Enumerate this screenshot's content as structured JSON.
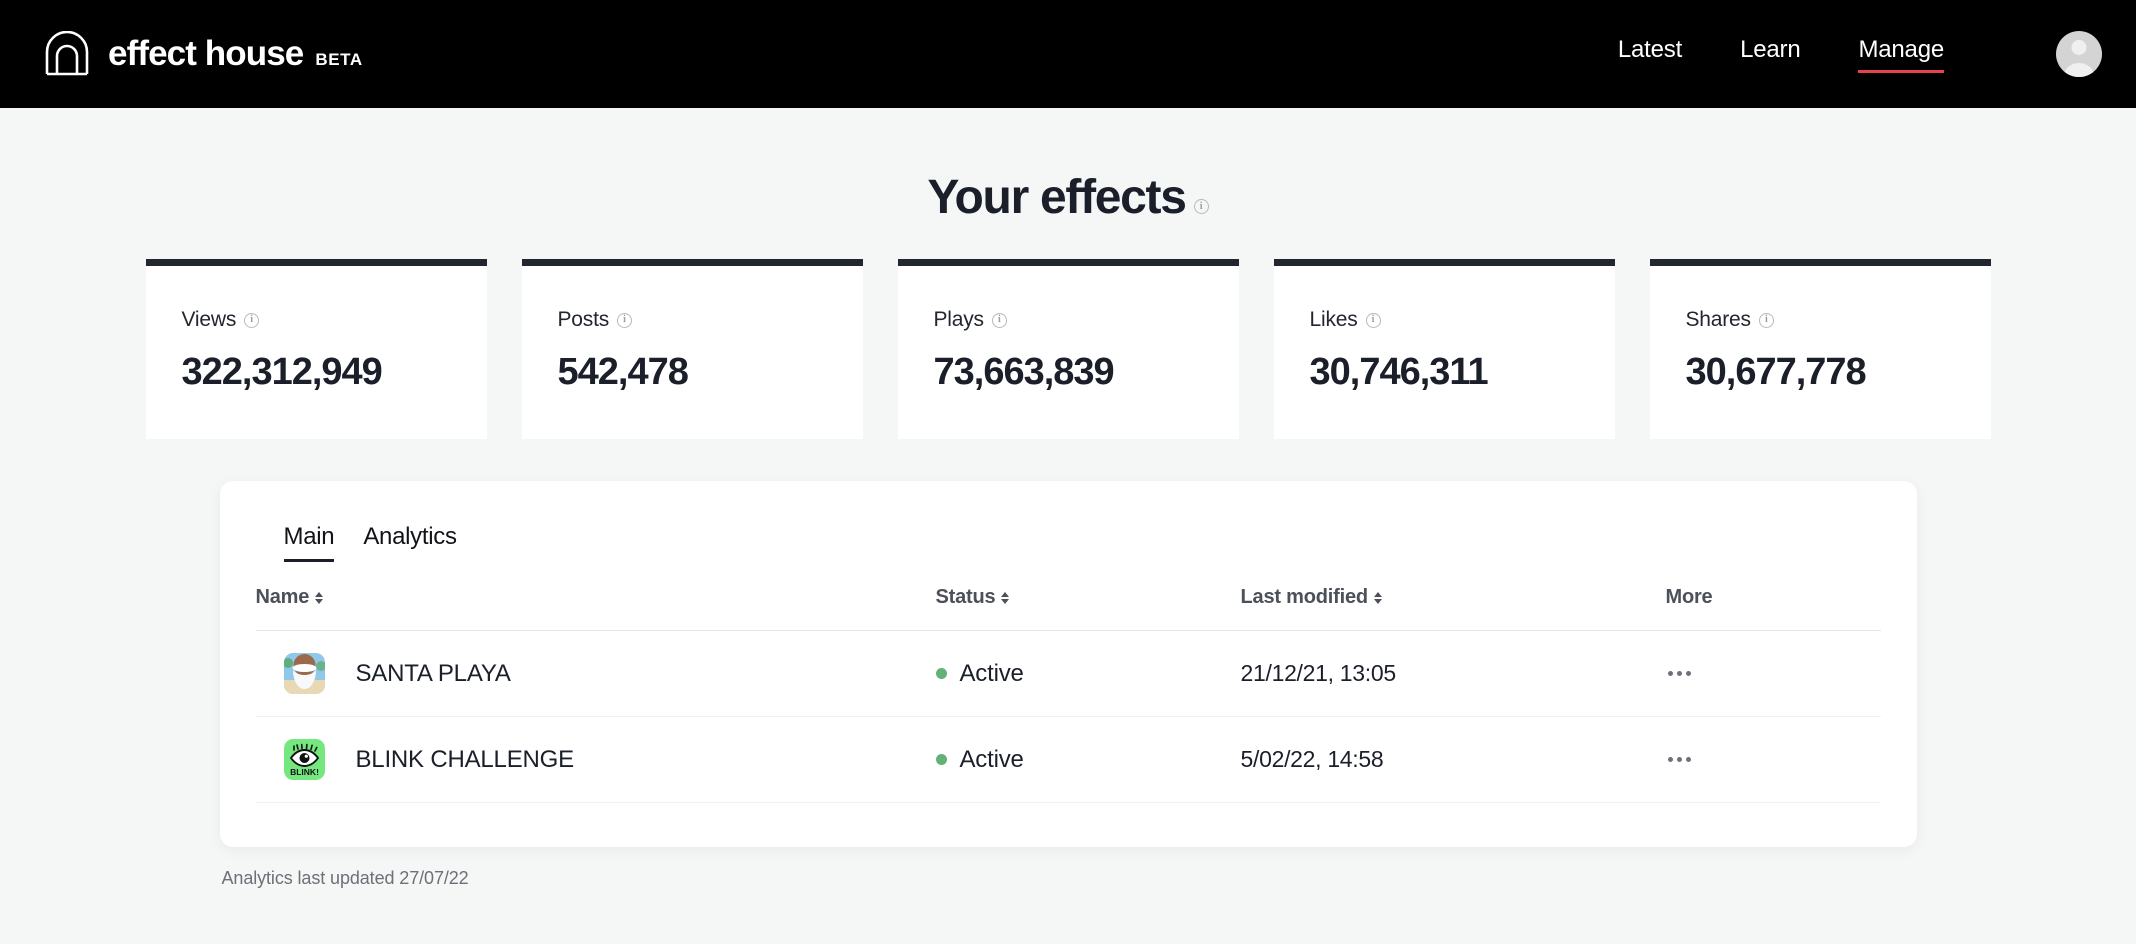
{
  "header": {
    "brand_name": "effect house",
    "brand_badge": "BETA",
    "logo_icon": "effect-house-arch-logo",
    "nav": [
      {
        "label": "Latest",
        "active": false
      },
      {
        "label": "Learn",
        "active": false
      },
      {
        "label": "Manage",
        "active": true
      }
    ],
    "avatar_icon": "user-avatar-icon",
    "accent_color": "#e8414e",
    "background_color": "#000000"
  },
  "page": {
    "title": "Your effects",
    "title_info_icon": "info-icon",
    "background_color": "#f5f6f6"
  },
  "stats": [
    {
      "label": "Views",
      "value": "322,312,949",
      "info_icon": "info-icon"
    },
    {
      "label": "Posts",
      "value": "542,478",
      "info_icon": "info-icon"
    },
    {
      "label": "Plays",
      "value": "73,663,839",
      "info_icon": "info-icon"
    },
    {
      "label": "Likes",
      "value": "30,746,311",
      "info_icon": "info-icon"
    },
    {
      "label": "Shares",
      "value": "30,677,778",
      "info_icon": "info-icon"
    }
  ],
  "main": {
    "tabs": [
      {
        "label": "Main",
        "active": true
      },
      {
        "label": "Analytics",
        "active": false
      }
    ],
    "table": {
      "columns": [
        {
          "label": "Name",
          "sortable": true
        },
        {
          "label": "Status",
          "sortable": true
        },
        {
          "label": "Last modified",
          "sortable": true
        },
        {
          "label": "More",
          "sortable": false
        }
      ],
      "rows": [
        {
          "name": "SANTA PLAYA",
          "thumbnail_icon": "santa-beach-thumbnail",
          "status": "Active",
          "status_color": "#62b277",
          "last_modified": "21/12/21, 13:05",
          "more_icon": "more-options-icon"
        },
        {
          "name": "BLINK CHALLENGE",
          "thumbnail_icon": "blink-eye-thumbnail",
          "status": "Active",
          "status_color": "#62b277",
          "last_modified": "5/02/22, 14:58",
          "more_icon": "more-options-icon"
        }
      ]
    }
  },
  "footer": {
    "note": "Analytics last updated 27/07/22"
  }
}
